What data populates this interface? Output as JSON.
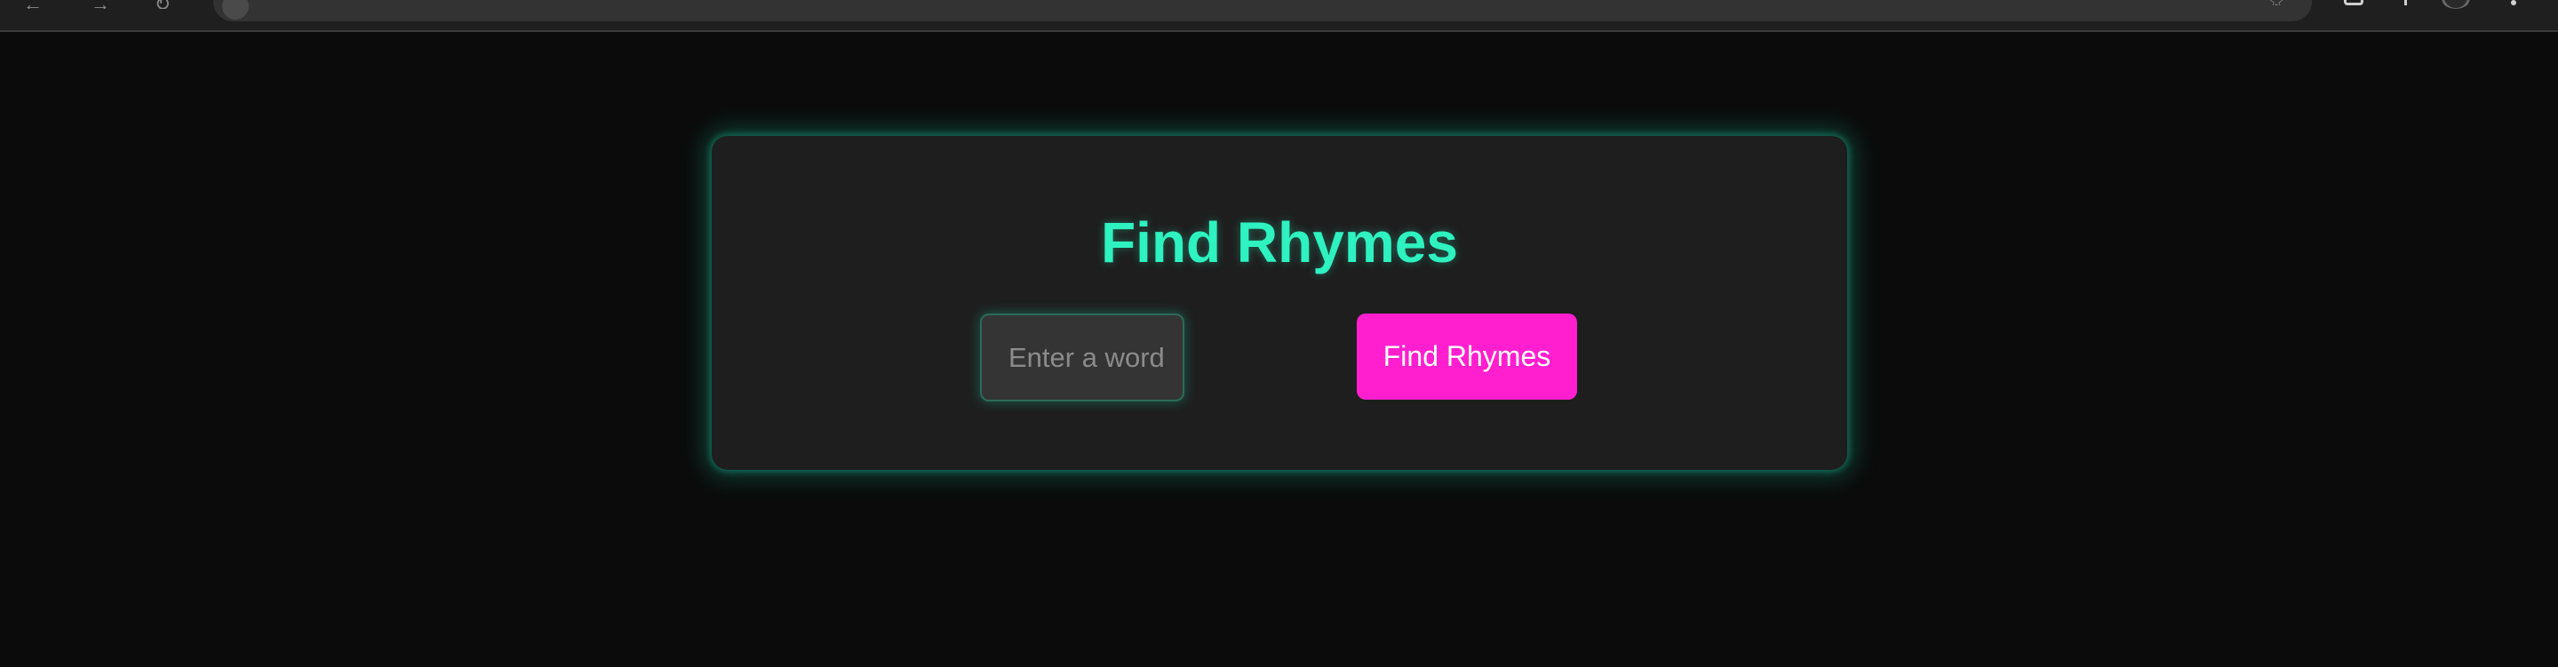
{
  "browser": {
    "back_icon": "←",
    "forward_icon": "→",
    "reload_icon": "↻",
    "star_icon": "☆"
  },
  "app": {
    "title": "Find Rhymes",
    "input": {
      "placeholder": "Enter a word",
      "value": ""
    },
    "button_label": "Find Rhymes"
  },
  "colors": {
    "page_background": "#0b0b0b",
    "card_background": "#1e1e1e",
    "title": "#2ef2c0",
    "glow": "#1de9b6",
    "button": "#ff1fcf",
    "button_text": "#ffffff",
    "input_background": "#343434"
  },
  "icons": [
    "back-arrow-icon",
    "forward-arrow-icon",
    "reload-icon",
    "site-info-icon",
    "bookmark-star-icon",
    "extensions-icon",
    "profile-avatar",
    "menu-icon"
  ]
}
